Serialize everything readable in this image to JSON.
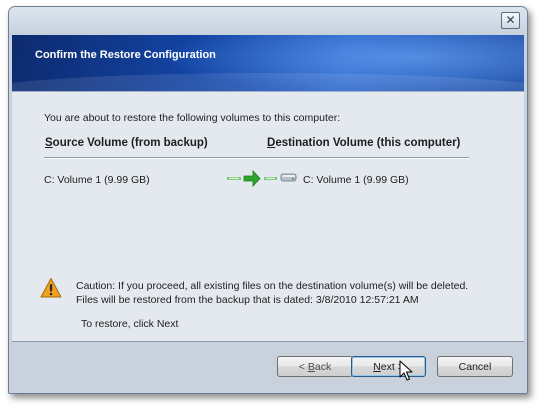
{
  "window": {
    "close_label": "✕"
  },
  "header": {
    "title": "Confirm the Restore Configuration"
  },
  "main": {
    "intro": "You are about to restore the following volumes to this computer:",
    "columns": {
      "source_first": "S",
      "source_rest": "ource Volume (from backup)",
      "dest_first": "D",
      "dest_rest": "estination Volume (this computer)"
    },
    "source_volume": "C: Volume 1 (9.99 GB)",
    "destination_volume": "C: Volume 1 (9.99 GB)",
    "caution_line1": "Caution: If you proceed, all existing files on the destination volume(s) will be deleted.",
    "caution_line2": "Files will be restored from the backup that is dated: 3/8/2010 12:57:21 AM",
    "restore_hint": "To restore, click Next"
  },
  "footer": {
    "back_prefix": "< ",
    "back_access": "B",
    "back_rest": "ack",
    "next_access": "N",
    "next_rest": "ext >",
    "cancel_label": "Cancel"
  },
  "icons": [
    "close-icon",
    "transfer-arrow-icon",
    "hard-drive-icon",
    "warning-icon",
    "mouse-cursor-icon"
  ],
  "colors": {
    "banner": "#1344a3",
    "arrow": "#2fa52b",
    "warning": "#f0a21f"
  }
}
